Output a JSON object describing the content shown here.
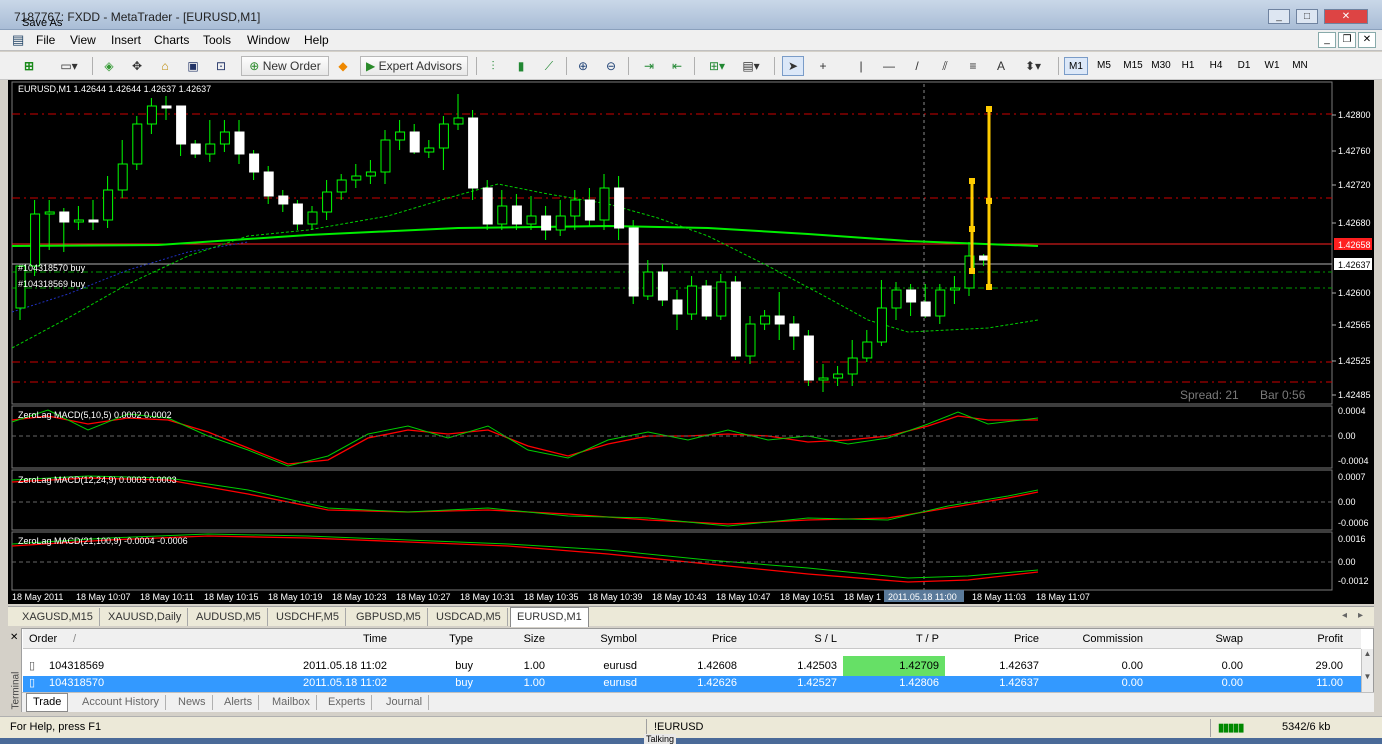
{
  "window": {
    "title": "7187767: FXDD - MetaTrader - [EURUSD,M1]",
    "dialog_ghost": "Save As"
  },
  "menu": [
    "File",
    "View",
    "Insert",
    "Charts",
    "Tools",
    "Window",
    "Help"
  ],
  "toolbar": {
    "new_order": "New Order",
    "expert_advisors": "Expert Advisors",
    "text_tool": "A",
    "timeframes": [
      "M1",
      "M5",
      "M15",
      "M30",
      "H1",
      "H4",
      "D1",
      "W1",
      "MN"
    ],
    "active_timeframe": "M1"
  },
  "chart": {
    "symbol_info": "EURUSD,M1  1.42644 1.42644 1.42637 1.42637",
    "order_labels": [
      "#104318570 buy",
      "#104318569 buy"
    ],
    "spread_label": "Spread: 21",
    "bar_label": "Bar  0:56",
    "price_axis": [
      "1.42800",
      "1.42760",
      "1.42720",
      "1.42680",
      "1.42658",
      "1.42637",
      "1.42600",
      "1.42565",
      "1.42525",
      "1.42485"
    ],
    "current_price": "1.42637",
    "ma_price": "1.42658",
    "indicators": [
      {
        "label": "ZeroLag MACD(5,10,5) 0.0002 0.0002",
        "ticks": [
          "0.0004",
          "0.00",
          "-0.0004"
        ]
      },
      {
        "label": "ZeroLag MACD(12,24,9) 0.0003 0.0003",
        "ticks": [
          "0.0007",
          "0.00",
          "-0.0006"
        ]
      },
      {
        "label": "ZeroLag MACD(21,100,9) -0.0004 -0.0006",
        "ticks": [
          "0.0016",
          "0.00",
          "-0.0012"
        ]
      }
    ],
    "time_axis": [
      "18 May 2011",
      "18 May 10:07",
      "18 May 10:11",
      "18 May 10:15",
      "18 May 10:19",
      "18 May 10:23",
      "18 May 10:27",
      "18 May 10:31",
      "18 May 10:35",
      "18 May 10:39",
      "18 May 10:43",
      "18 May 10:47",
      "18 May 10:51",
      "18 May 1",
      "18 May 11:03",
      "18 May 11:07"
    ],
    "crosshair_time": "2011.05.18 11:00",
    "colors": {
      "bg": "#000000",
      "up": "#00ff00",
      "ma": "#00ff00",
      "level": "#ff0000",
      "macd": "#ff0000",
      "signal": "#00ff00",
      "tp": "#ffcc00"
    }
  },
  "chart_tabs": [
    "XAGUSD,M15",
    "XAUUSD,Daily",
    "AUDUSD,M5",
    "USDCHF,M5",
    "GBPUSD,M5",
    "USDCAD,M5",
    "EURUSD,M1"
  ],
  "active_chart_tab": "EURUSD,M1",
  "terminal": {
    "side_label": "Terminal",
    "columns": [
      "Order",
      "/",
      "Time",
      "Type",
      "Size",
      "Symbol",
      "Price",
      "S / L",
      "T / P",
      "Price",
      "Commission",
      "Swap",
      "Profit"
    ],
    "rows": [
      {
        "order": "104318569",
        "time": "2011.05.18 11:02",
        "type": "buy",
        "size": "1.00",
        "symbol": "eurusd",
        "price": "1.42608",
        "sl": "1.42503",
        "tp": "1.42709",
        "cur": "1.42637",
        "commission": "0.00",
        "swap": "0.00",
        "profit": "29.00"
      },
      {
        "order": "104318570",
        "time": "2011.05.18 11:02",
        "type": "buy",
        "size": "1.00",
        "symbol": "eurusd",
        "price": "1.42626",
        "sl": "1.42527",
        "tp": "1.42806",
        "cur": "1.42637",
        "commission": "0.00",
        "swap": "0.00",
        "profit": "11.00"
      }
    ],
    "tabs": [
      "Trade",
      "Account History",
      "News",
      "Alerts",
      "Mailbox",
      "Experts",
      "Journal"
    ],
    "active_tab": "Trade"
  },
  "status": {
    "help": "For Help, press F1",
    "symbol": "!EURUSD",
    "traffic": "5342/6 kb",
    "taskbar_hint": "Talking"
  }
}
